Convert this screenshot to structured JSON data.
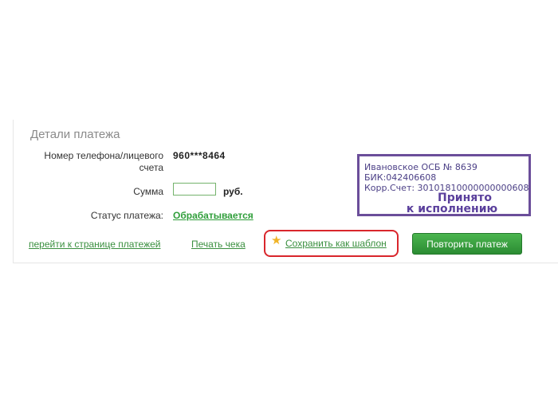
{
  "details": {
    "title": "Детали платежа",
    "phone_label": "Номер телефона/лицевого счета",
    "phone_value": "960***8464",
    "sum_label": "Сумма",
    "sum_value": "",
    "sum_unit": "руб.",
    "status_label": "Статус платежа:",
    "status_value": "Обрабатывается"
  },
  "stamp": {
    "line1": "Ивановское ОСБ № 8639",
    "line2": "БИК:042406608",
    "line3": "Корр.Счет: 30101810000000000608",
    "big1": "Принято",
    "big2": "к исполнению"
  },
  "actions": {
    "payments_link": "перейти к странице платежей",
    "print_link": "Печать чека",
    "template_link": "Сохранить как шаблон",
    "repeat_button": "Повторить платеж"
  },
  "colors": {
    "accent_green": "#2f9e3a",
    "highlight_red": "#d9262c",
    "stamp_purple": "#6b4e9a"
  },
  "icons": {
    "template": "star-icon"
  }
}
